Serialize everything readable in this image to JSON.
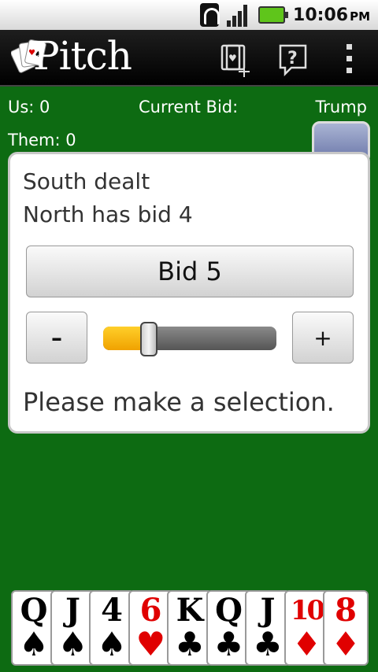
{
  "status_bar": {
    "time": "10:06",
    "ampm": "PM"
  },
  "app": {
    "title": "Pitch"
  },
  "hud": {
    "us": "Us: 0",
    "current_bid": "Current Bid:",
    "trump": "Trump",
    "them": "Them: 0"
  },
  "dialog": {
    "line1": "South dealt",
    "line2": "North has bid 4",
    "bid_button": "Bid 5",
    "minus": "–",
    "plus": "+",
    "slider_fraction": 0.2,
    "message": "Please make a selection."
  },
  "hand": [
    {
      "rank": "Q",
      "suit": "♠",
      "color": "black"
    },
    {
      "rank": "J",
      "suit": "♠",
      "color": "black"
    },
    {
      "rank": "4",
      "suit": "♠",
      "color": "black"
    },
    {
      "rank": "6",
      "suit": "♥",
      "color": "red"
    },
    {
      "rank": "K",
      "suit": "♣",
      "color": "black"
    },
    {
      "rank": "Q",
      "suit": "♣",
      "color": "black"
    },
    {
      "rank": "J",
      "suit": "♣",
      "color": "black"
    },
    {
      "rank": "10",
      "suit": "♦",
      "color": "red"
    },
    {
      "rank": "8",
      "suit": "♦",
      "color": "red"
    }
  ],
  "icons": {
    "new_game": "new-game-icon",
    "help": "help-icon",
    "overflow": "overflow-menu-icon"
  },
  "colors": {
    "felt": "#0d6b12",
    "slider_fill": "#f0a200",
    "red_suit": "#e00000"
  }
}
